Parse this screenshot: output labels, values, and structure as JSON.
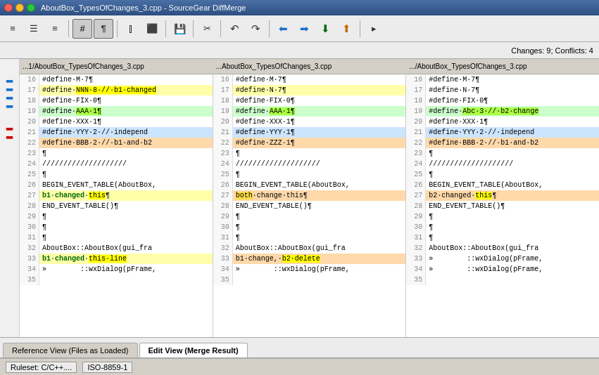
{
  "titleBar": {
    "title": "AboutBox_TypesOfChanges_3.cpp - SourceGear DiffMerge",
    "closeBtn": "×",
    "minBtn": "−",
    "maxBtn": "□"
  },
  "toolbar": {
    "buttons": [
      {
        "name": "align-left",
        "icon": "≡",
        "tooltip": "Align Left"
      },
      {
        "name": "align-center",
        "icon": "☰",
        "tooltip": "Align Center"
      },
      {
        "name": "align-right",
        "icon": "≡",
        "tooltip": "Align Right"
      },
      {
        "name": "hash",
        "icon": "#",
        "tooltip": "Toggle Line Numbers",
        "active": true
      },
      {
        "name": "pilcrow",
        "icon": "¶",
        "tooltip": "Toggle Whitespace",
        "active": true
      },
      {
        "name": "columns",
        "icon": "⫿",
        "tooltip": "Columns"
      },
      {
        "name": "rows",
        "icon": "⬜",
        "tooltip": "Rows"
      },
      {
        "name": "save",
        "icon": "💾",
        "tooltip": "Save"
      },
      {
        "name": "scissors",
        "icon": "✂",
        "tooltip": "Cut"
      },
      {
        "name": "prev-change",
        "icon": "↶",
        "tooltip": "Previous Change"
      },
      {
        "name": "next-change",
        "icon": "↷",
        "tooltip": "Next Change"
      },
      {
        "name": "merge-left",
        "icon": "⬅",
        "tooltip": "Merge Left"
      },
      {
        "name": "merge-right",
        "icon": "➡",
        "tooltip": "Merge Right"
      },
      {
        "name": "more",
        "icon": "▸",
        "tooltip": "More"
      }
    ]
  },
  "panels": [
    {
      "id": "panel1",
      "header": "...1/AboutBox_TypesOfChanges_3.cpp",
      "lines": [
        {
          "num": 16,
          "content": "#define·M·7¶",
          "bg": ""
        },
        {
          "num": 17,
          "content": "#define·NNN·8·//·b1·changed",
          "bg": "yellow"
        },
        {
          "num": 18,
          "content": "#define·FIX·0¶",
          "bg": ""
        },
        {
          "num": 19,
          "content": "#define·AAA·1¶",
          "bg": "green"
        },
        {
          "num": 20,
          "content": "#define·XXX·1¶",
          "bg": ""
        },
        {
          "num": 21,
          "content": "#define·YYY·2·//·independ",
          "bg": "blue"
        },
        {
          "num": 22,
          "content": "#define·BBB·2·//·b1·and·b2",
          "bg": "orange"
        },
        {
          "num": 23,
          "content": "¶",
          "bg": ""
        },
        {
          "num": 24,
          "content": "////////////////////",
          "bg": ""
        },
        {
          "num": 25,
          "content": "¶",
          "bg": ""
        },
        {
          "num": 26,
          "content": "BEGIN_EVENT_TABLE(AboutBox,",
          "bg": ""
        },
        {
          "num": 27,
          "content": "b1·changed·this¶",
          "bg": "yellow"
        },
        {
          "num": 28,
          "content": "END_EVENT_TABLE()¶",
          "bg": ""
        },
        {
          "num": 29,
          "content": "¶",
          "bg": ""
        },
        {
          "num": 30,
          "content": "¶",
          "bg": ""
        },
        {
          "num": 31,
          "content": "¶",
          "bg": ""
        },
        {
          "num": 32,
          "content": "AboutBox::AboutBox(gui_fra",
          "bg": ""
        },
        {
          "num": 33,
          "content": "b1·changed·this·line",
          "bg": "yellow"
        },
        {
          "num": 34,
          "content": "»        ::wxDialog(pFrame,",
          "bg": ""
        },
        {
          "num": 35,
          "content": "",
          "bg": ""
        }
      ]
    },
    {
      "id": "panel2",
      "header": "...AboutBox_TypesOfChanges_3.cpp",
      "lines": [
        {
          "num": 16,
          "content": "#define·M·7¶",
          "bg": ""
        },
        {
          "num": 17,
          "content": "#define·N·7¶",
          "bg": "yellow"
        },
        {
          "num": 18,
          "content": "#define·FIX·0¶",
          "bg": ""
        },
        {
          "num": 19,
          "content": "#define·AAA·1¶",
          "bg": "green"
        },
        {
          "num": 20,
          "content": "#define·XXX·1¶",
          "bg": ""
        },
        {
          "num": 21,
          "content": "#define·YYY·1¶",
          "bg": "blue"
        },
        {
          "num": 22,
          "content": "#define·ZZZ·1¶",
          "bg": "orange"
        },
        {
          "num": 23,
          "content": "¶",
          "bg": ""
        },
        {
          "num": 24,
          "content": "////////////////////",
          "bg": ""
        },
        {
          "num": 25,
          "content": "¶",
          "bg": ""
        },
        {
          "num": 26,
          "content": "BEGIN_EVENT_TABLE(AboutBox,",
          "bg": ""
        },
        {
          "num": 27,
          "content": "both·change·this¶",
          "bg": "orange"
        },
        {
          "num": 28,
          "content": "END_EVENT_TABLE()¶",
          "bg": ""
        },
        {
          "num": 29,
          "content": "¶",
          "bg": ""
        },
        {
          "num": 30,
          "content": "¶",
          "bg": ""
        },
        {
          "num": 31,
          "content": "¶",
          "bg": ""
        },
        {
          "num": 32,
          "content": "AboutBox::AboutBox(gui_fra",
          "bg": ""
        },
        {
          "num": 33,
          "content": "b1·change,·b2·delete",
          "bg": "orange"
        },
        {
          "num": 34,
          "content": "»        ::wxDialog(pFrame,",
          "bg": ""
        },
        {
          "num": 35,
          "content": "",
          "bg": ""
        }
      ]
    },
    {
      "id": "panel3",
      "header": ".../AboutBox_TypesOfChanges_3.cpp",
      "lines": [
        {
          "num": 16,
          "content": "#define·M·7¶",
          "bg": ""
        },
        {
          "num": 17,
          "content": "#define·N·7¶",
          "bg": ""
        },
        {
          "num": 18,
          "content": "#define·FIX·0¶",
          "bg": ""
        },
        {
          "num": 19,
          "content": "#define·Abc·3·//·b2·change",
          "bg": "green"
        },
        {
          "num": 20,
          "content": "#define·XXX·1¶",
          "bg": ""
        },
        {
          "num": 21,
          "content": "#define·YYY·2·//·independ",
          "bg": "blue"
        },
        {
          "num": 22,
          "content": "#define·BBB·2·//·b1·and·b2",
          "bg": "orange"
        },
        {
          "num": 23,
          "content": "¶",
          "bg": ""
        },
        {
          "num": 24,
          "content": "////////////////////",
          "bg": ""
        },
        {
          "num": 25,
          "content": "¶",
          "bg": ""
        },
        {
          "num": 26,
          "content": "BEGIN_EVENT_TABLE(AboutBox,",
          "bg": ""
        },
        {
          "num": 27,
          "content": "b2·changed·this¶",
          "bg": "orange"
        },
        {
          "num": 28,
          "content": "END_EVENT_TABLE()¶",
          "bg": ""
        },
        {
          "num": 29,
          "content": "¶",
          "bg": ""
        },
        {
          "num": 30,
          "content": "¶",
          "bg": ""
        },
        {
          "num": 31,
          "content": "¶",
          "bg": ""
        },
        {
          "num": 32,
          "content": "AboutBox::AboutBox(gui_fra",
          "bg": ""
        },
        {
          "num": 33,
          "content": "»        ::wxDialog(pFrame,",
          "bg": ""
        },
        {
          "num": 34,
          "content": "»        ::wxDialog(pFrame,",
          "bg": ""
        },
        {
          "num": 35,
          "content": "",
          "bg": ""
        }
      ]
    }
  ],
  "changesBar": {
    "text": "Changes: 9; Conflicts: 4"
  },
  "tabs": [
    {
      "label": "Reference View (Files as Loaded)",
      "active": false
    },
    {
      "label": "Edit View (Merge Result)",
      "active": true
    }
  ],
  "statusBar": {
    "ruleset": "Ruleset: C/C++....",
    "encoding": "ISO-8859-1"
  }
}
